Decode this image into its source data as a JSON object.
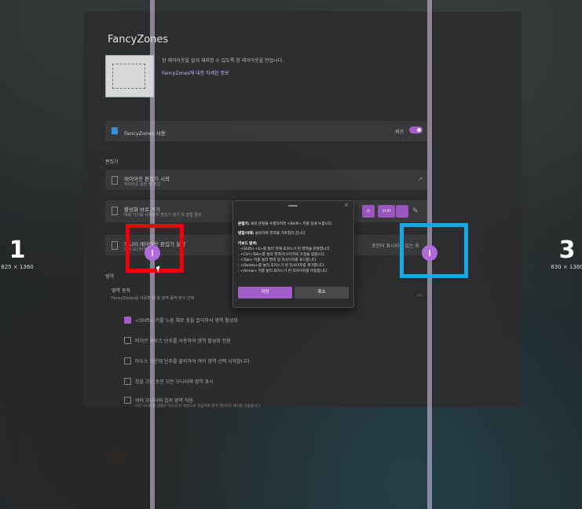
{
  "zones": [
    {
      "number": "1",
      "size": "825 × 1360"
    },
    {
      "number": "3",
      "size": "830 × 1360"
    }
  ],
  "window": {
    "title": "FancyZones",
    "description": "창 레이아웃을 쉽게 재지정 수 있도록 창 레이아웃을 만듭니다.",
    "learn_more": "FancyZones에 대한 자세한 정보",
    "enable_label": "FancyZones 사용",
    "toggle_label": "켜기",
    "editor_section": "편집기",
    "launch_editor": "레이아웃 편집기 시작",
    "launch_editor_sub": "레이아웃 설정 및 편집",
    "hotkey_label": "활성화 바로 가기",
    "hotkey_sub": "바로 가기를 사용하여 편집기 열기 위 방법 활성",
    "hotkey_keys": [
      "⊞",
      "Shift",
      "`"
    ],
    "monitor_label": "모니터 레이아웃 편집기 실행",
    "monitor_sub": "모든 모니터에서",
    "zones_section": "영역",
    "zone_behavior": "영역 동작",
    "zone_behavior_sub": "FancyZones를 사용할 때 창 영역 동작 방식 선택",
    "right_text": "포인터 표시되어 있는 화",
    "options": [
      {
        "text": "<Shift> 키를 누른 채로 창을 끌어와서 영역 활성화",
        "checked": true
      },
      {
        "text": "비거르 마우스 단추를 사용하여 영역 활성화 전환",
        "checked": false
      },
      {
        "text": "마우스 가운데 단추를 클릭하여 여러 영역 선택 시작합니다.",
        "checked": false
      },
      {
        "text": "창을 끄는 동안 모든 모니터에 영역 표시",
        "checked": false
      },
      {
        "text": "여러 모니터에 걸쳐 영역 허용",
        "checked": false
      }
    ],
    "footer_text": "모든 모니터를 결합한 하나의 큰 화면으로 취급하여 영역 레이아웃 배치를 허용합니다."
  },
  "dialog": {
    "lines": [
      {
        "bold": "분할기:",
        "text": " 새로 분할을 수행하려면 <Shift> 키를 길게 누릅니다."
      },
      {
        "bold": "병합/삭제:",
        "text": " 클릭하여 영역을 가로질러 끕니다."
      },
      {
        "bold": "키보드 탐색:",
        "text": ""
      },
      {
        "bold": "",
        "text": "- <Shift>+S>를 눌러 현재 포커스가 된 영역을 분할합니다."
      },
      {
        "bold": "",
        "text": "- <Ctrl+Tab>를 눌러 영역/리사이저의 초점을 맞춥니다."
      },
      {
        "bold": "",
        "text": "- <Tab> 키를 눌러 영역 및 리사이저를 표시합니다."
      },
      {
        "bold": "",
        "text": "- <Delete>를 눌러 포커스가 된 리사이저를 제거합니다."
      },
      {
        "bold": "",
        "text": "- <Arrow> 키를 눌러 포커스가 된 리사이저를 이동합니다."
      }
    ],
    "save": "저장",
    "cancel": "취소",
    "close": "×"
  },
  "colors": {
    "accent": "#a35cc9",
    "highlight_red": "#f00008",
    "highlight_blue": "#11a9e8"
  }
}
